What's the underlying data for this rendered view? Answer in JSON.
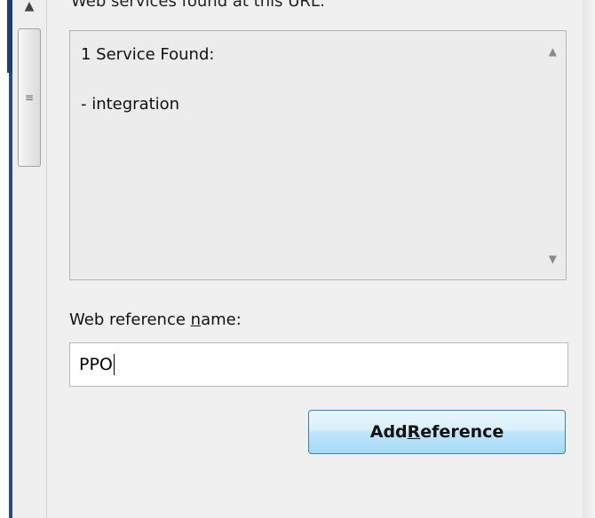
{
  "services": {
    "heading": "Web services found at this URL:",
    "lines": [
      "1 Service Found:",
      "- integration"
    ]
  },
  "reference": {
    "label_prefix": "Web reference ",
    "label_underlined": "n",
    "label_suffix": "ame:",
    "value": "PPO"
  },
  "add_button": {
    "prefix": "Add ",
    "underlined": "R",
    "suffix": "eference"
  },
  "icons": {
    "scroll_up": "▲",
    "grip": "≡",
    "box_up": "▲",
    "box_down": "▼"
  }
}
